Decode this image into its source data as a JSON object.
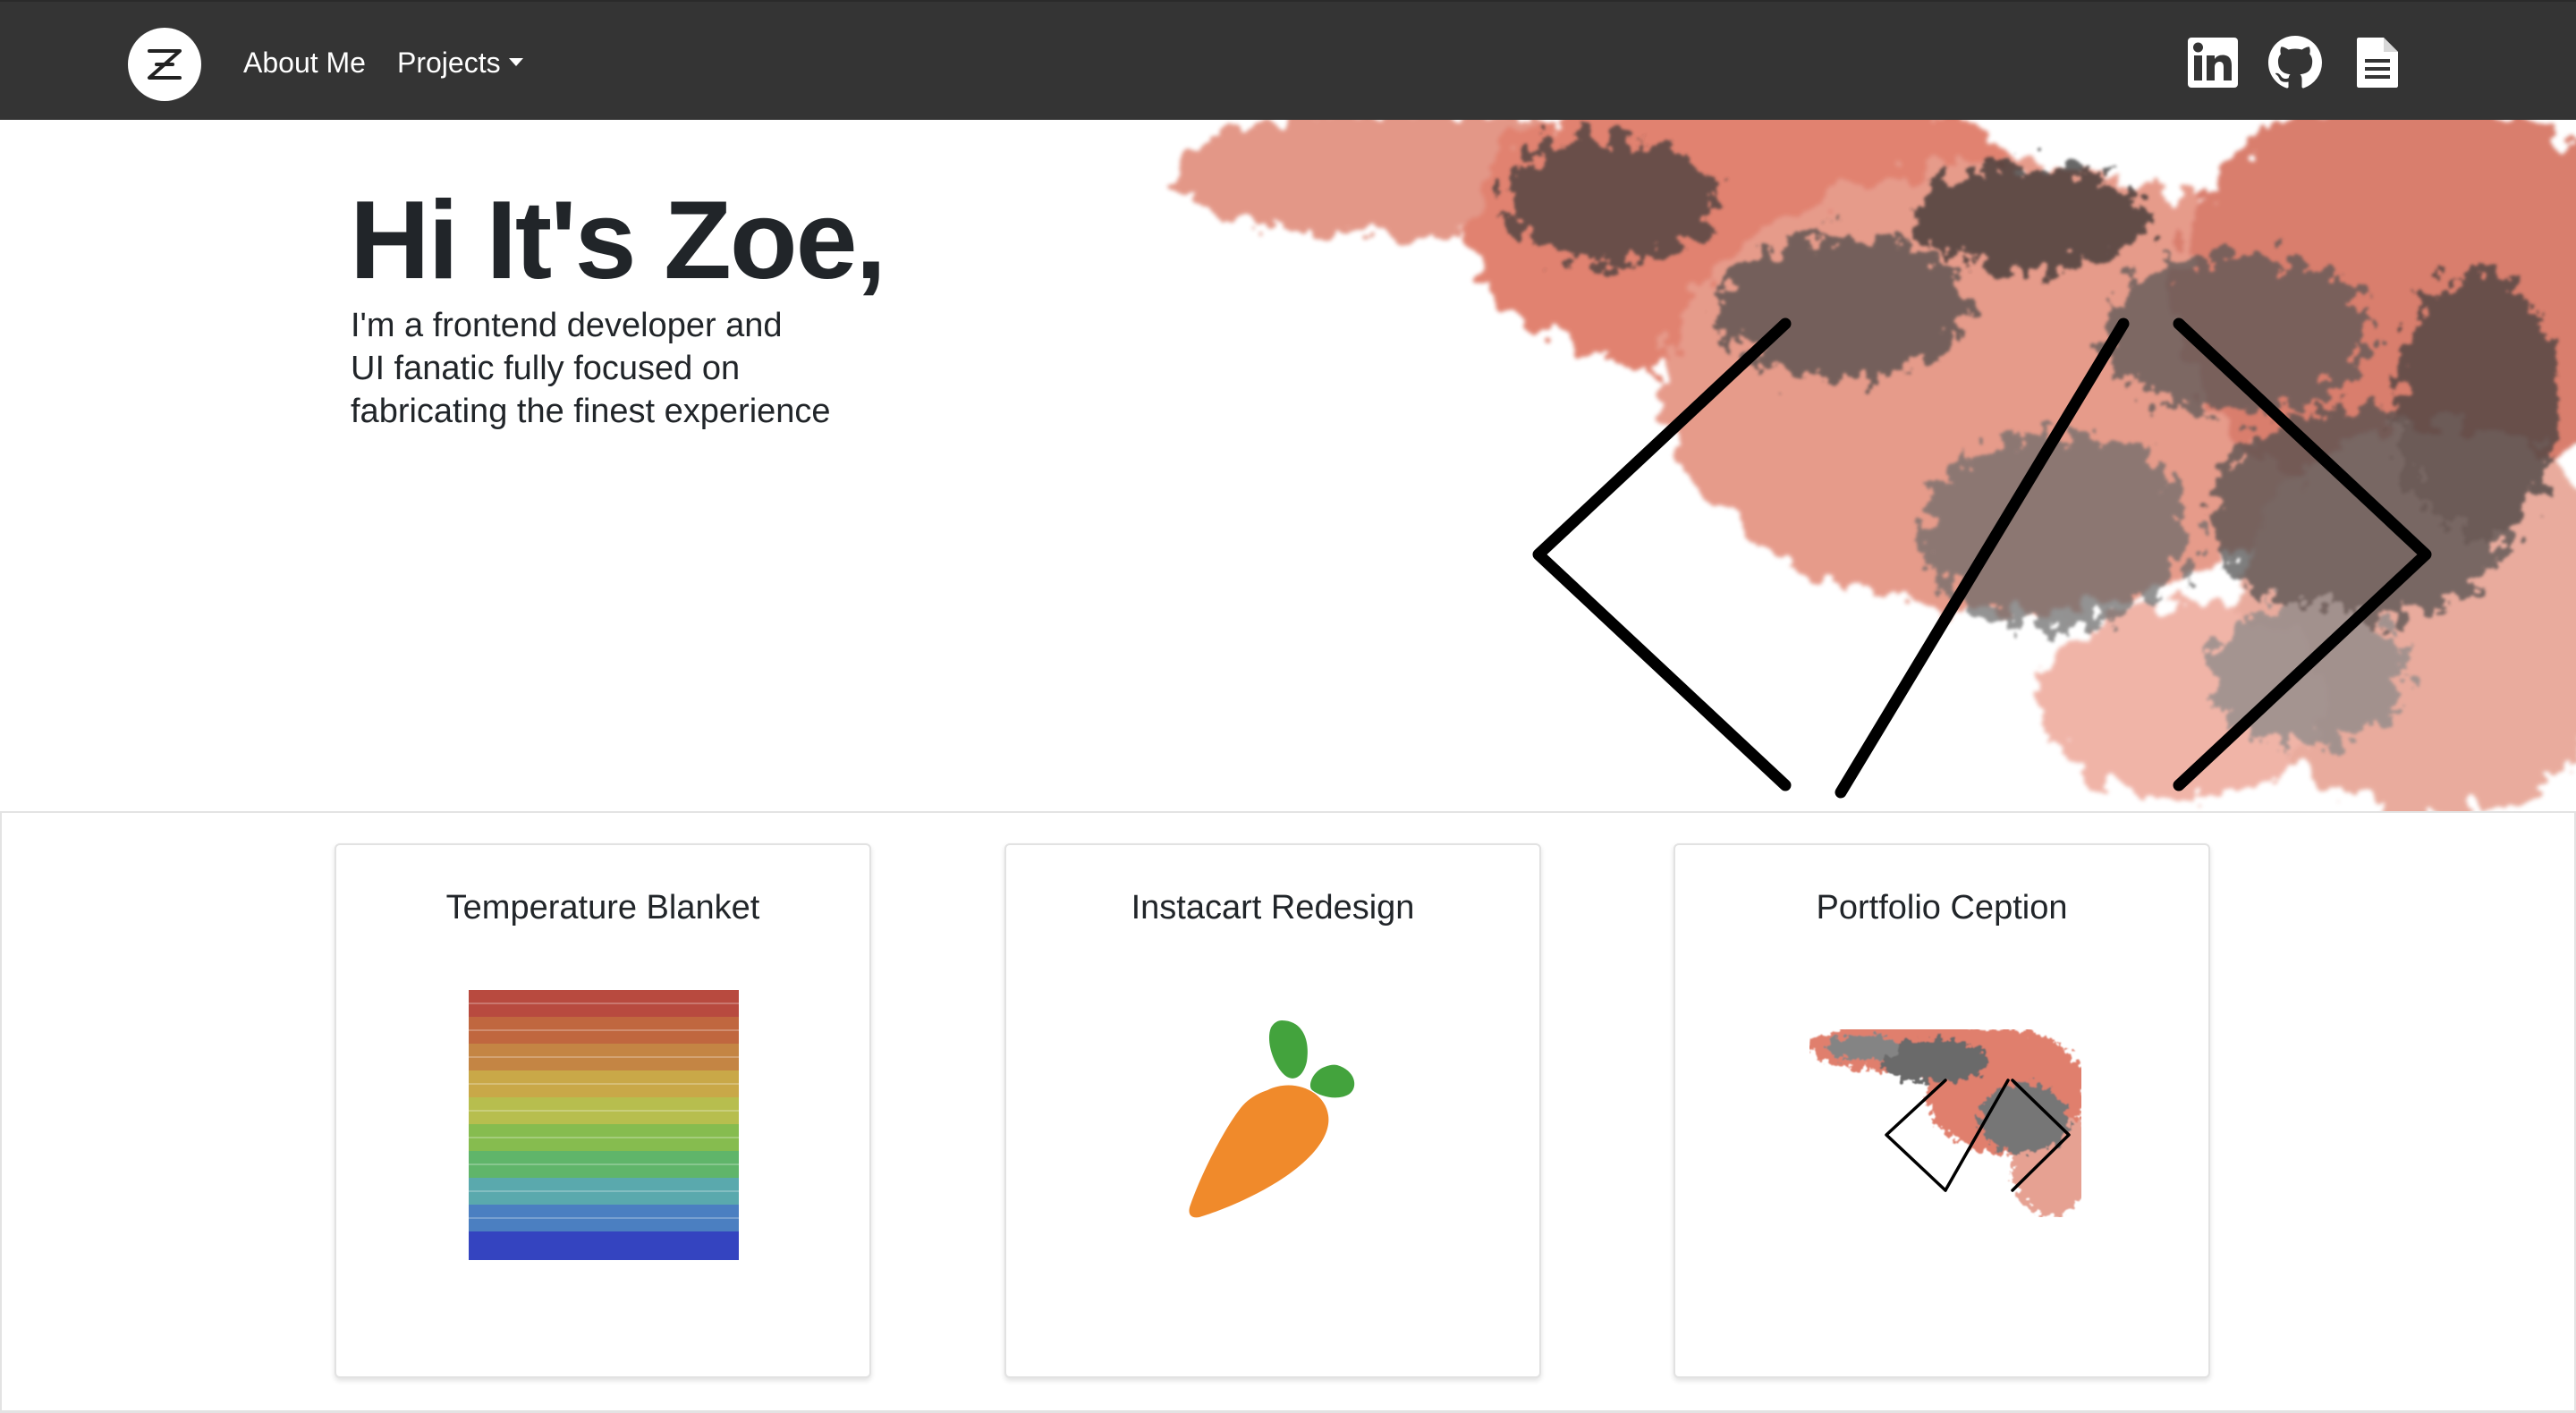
{
  "nav": {
    "brand_letter": "Z",
    "about_label": "About Me",
    "projects_label": "Projects",
    "social": [
      "linkedin-icon",
      "github-icon",
      "resume-document-icon"
    ]
  },
  "hero": {
    "title": "Hi It's Zoe,",
    "subtitle_line1": "I'm a frontend developer and",
    "subtitle_line2": "UI fanatic fully focused on",
    "subtitle_line3": "fabricating the finest experience"
  },
  "projects": [
    {
      "title": "Temperature Blanket",
      "image": "rainbow-stripes-blanket"
    },
    {
      "title": "Instacart Redesign",
      "image": "carrot-logo"
    },
    {
      "title": "Portfolio Ception",
      "image": "code-brackets-art"
    }
  ],
  "colors": {
    "navbar": "#343434",
    "text": "#212529",
    "accent_red": "#d9604a",
    "carrot_orange": "#f08a2b",
    "carrot_green": "#43a33d"
  }
}
